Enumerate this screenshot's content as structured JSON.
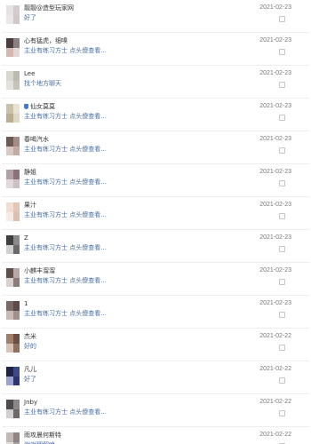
{
  "messages": [
    {
      "name": "靓靓@造型玩家网",
      "msg": "好了",
      "date": "2021-02-23",
      "avatar": [
        "#e7e2e2",
        "#d4cccc",
        "#ece7e7",
        "#cfc7c8"
      ]
    },
    {
      "name": "心有猛虎，细嗅",
      "msg": "主业有练习方士 点头傻查看...",
      "date": "2021-02-23",
      "avatar": [
        "#4a3d3d",
        "#8c7f80",
        "#d4b9b2",
        "#e0d6d5"
      ]
    },
    {
      "name": "Lee",
      "msg": "找个地方聊天",
      "date": "2021-02-23",
      "avatar": [
        "#d9d6d0",
        "#bfbab0",
        "#e4e1dc",
        "#c8c3ba"
      ]
    },
    {
      "name": "仙女莫莫",
      "msg": "主业有练习方士 点头傻查看...",
      "date": "2021-02-23",
      "vip": true,
      "avatar": [
        "#c9c1a9",
        "#e8e2d2",
        "#b9ae91",
        "#ded7c6"
      ]
    },
    {
      "name": "春喝汽水",
      "msg": "主业有练习方士 点头傻查看...",
      "date": "2021-02-23",
      "avatar": [
        "#6d5a55",
        "#a58d86",
        "#d8c9c4",
        "#c2aba4"
      ]
    },
    {
      "name": "静姐",
      "msg": "主业有练习方士 点头傻查看...",
      "date": "2021-02-23",
      "avatar": [
        "#b3a1a6",
        "#8d7179",
        "#e3d8da",
        "#cfbfc3"
      ]
    },
    {
      "name": "果汁",
      "msg": "主业有练习方士 点头傻查看...",
      "date": "2021-02-23",
      "avatar": [
        "#f2ddd2",
        "#e6c5b6",
        "#f7ebe5",
        "#dcbfb0"
      ]
    },
    {
      "name": "Z",
      "msg": "主业有练习方士 点头傻查看...",
      "date": "2021-02-23",
      "avatar": [
        "#3f3f3f",
        "#8a8a8a",
        "#cfcfcf",
        "#6a6a6a"
      ]
    },
    {
      "name": "小麒丰溜溜",
      "msg": "主业有练习方士 点头傻查看...",
      "date": "2021-02-23",
      "avatar": [
        "#5e4f4c",
        "#b6a8a6",
        "#d9cfcd",
        "#8c7b78"
      ]
    },
    {
      "name": "1",
      "msg": "主业有练习方士 点头傻查看...",
      "date": "2021-02-23",
      "avatar": [
        "#7a6a68",
        "#5a4a48",
        "#c9b9b7",
        "#a08f8d"
      ]
    },
    {
      "name": "杰米",
      "msg": "好的",
      "date": "2021-02-22",
      "avatar": [
        "#a07f6b",
        "#6b4f40",
        "#d6c2b6",
        "#8f7060"
      ]
    },
    {
      "name": "凡儿",
      "msg": "好了",
      "date": "2021-02-22",
      "avatar": [
        "#20224a",
        "#3c4a8c",
        "#9aa3cf",
        "#2d3470"
      ]
    },
    {
      "name": "Jnby",
      "msg": "主业有练习方士 点头傻查看...",
      "date": "2021-02-22",
      "avatar": [
        "#514a4a",
        "#8c8585",
        "#d3cfcf",
        "#6e6767"
      ]
    },
    {
      "name": "雨攻晨何斯特",
      "msg": "谢谢理解哈",
      "date": "2021-02-22",
      "avatar": [
        "#c2b8b6",
        "#8e8482",
        "#e4dfde",
        "#a99f9d"
      ]
    }
  ]
}
